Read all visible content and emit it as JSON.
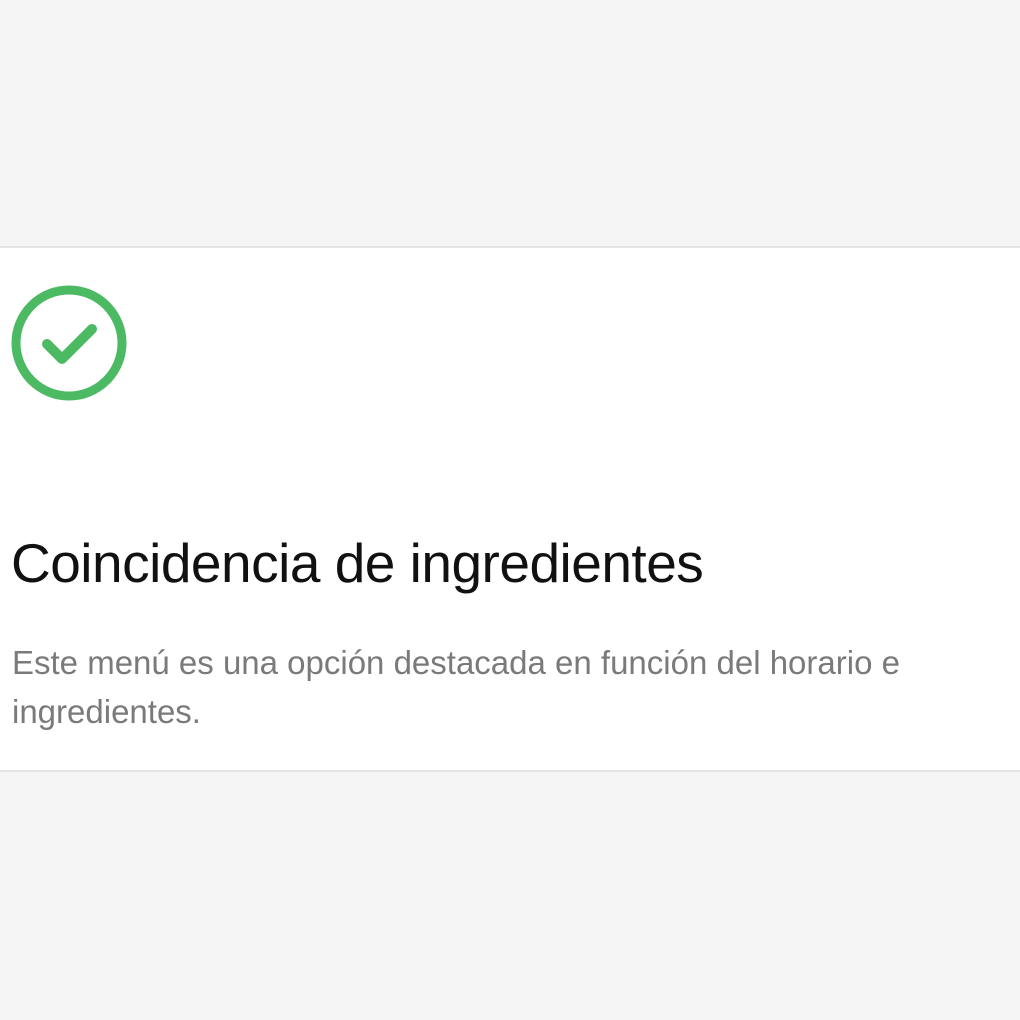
{
  "card": {
    "icon": "check-circle-icon",
    "title": "Coincidencia de ingredientes",
    "description": "Este menú es una opción destacada en función del horario e ingredientes."
  },
  "colors": {
    "background": "#f5f5f5",
    "card": "#ffffff",
    "card_border": "#e4e4e4",
    "accent_green": "#4cb963",
    "title_text": "#111111",
    "description_text": "#7a7a7a"
  }
}
